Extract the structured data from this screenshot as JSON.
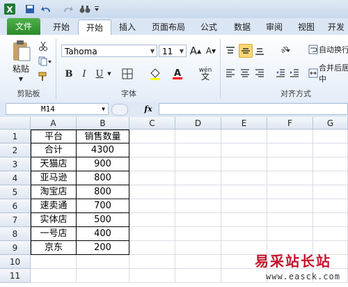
{
  "colors": {
    "file_tab": "#2c8a2a",
    "ribbon_bg": "#e4edf8",
    "highlight": "#fbd774",
    "watermark": "#c4132b"
  },
  "tabs": [
    "文件",
    "开始",
    "插入",
    "页面布局",
    "公式",
    "数据",
    "审阅",
    "视图",
    "开发"
  ],
  "ribbon": {
    "paste_label": "粘贴",
    "font_name": "Tahoma",
    "font_size": "11",
    "grow_font": "A",
    "shrink_font": "A",
    "bold": "B",
    "italic": "I",
    "underline": "U",
    "font_color_glyph": "A",
    "phonetic_glyph": "wén",
    "wrap_text": "自动换行",
    "merge_center": "合并后居中",
    "group_clipboard": "剪贴板",
    "group_font": "字体",
    "group_align": "对齐方式"
  },
  "formula": {
    "name_box": "M14",
    "fx": "fx",
    "value": ""
  },
  "columns": [
    "A",
    "B",
    "C",
    "D",
    "E",
    "F",
    "G"
  ],
  "rows": [
    "1",
    "2",
    "3",
    "4",
    "5",
    "6",
    "7",
    "8",
    "9",
    "10",
    "11"
  ],
  "table": {
    "header": [
      "平台",
      "销售数量"
    ],
    "rows": [
      [
        "合计",
        "4300"
      ],
      [
        "天猫店",
        "900"
      ],
      [
        "亚马逊",
        "800"
      ],
      [
        "淘宝店",
        "800"
      ],
      [
        "速卖通",
        "700"
      ],
      [
        "实体店",
        "500"
      ],
      [
        "一号店",
        "400"
      ],
      [
        "京东",
        "200"
      ]
    ]
  },
  "watermark": {
    "title": "易采站长站",
    "url": "www.easck.com"
  }
}
